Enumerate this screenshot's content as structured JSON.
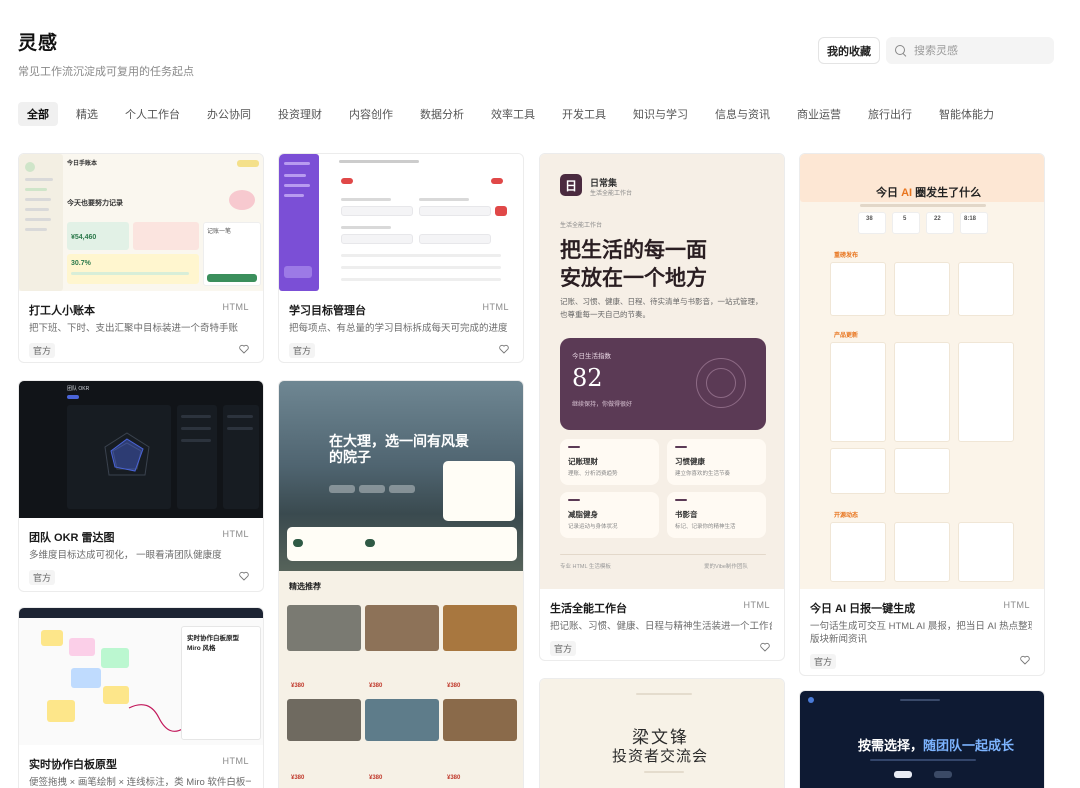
{
  "header": {
    "title": "灵感",
    "subtitle": "常见工作流沉淀成可复用的任务起点"
  },
  "actions": {
    "favorites_label": "我的收藏",
    "search_placeholder": "搜索灵感"
  },
  "tabs": [
    "全部",
    "精选",
    "个人工作台",
    "办公协同",
    "投资理财",
    "内容创作",
    "数据分析",
    "效率工具",
    "开发工具",
    "知识与学习",
    "信息与资讯",
    "商业运营",
    "旅行出行",
    "智能体能力"
  ],
  "cards": [
    {
      "title": "打工人小账本",
      "type": "HTML",
      "desc": "把下班、下时、支出汇聚中目标装进一个奇特手账",
      "tag": "官方"
    },
    {
      "title": "学习目标管理台",
      "type": "HTML",
      "desc": "把每项点、有总量的学习目标拆成每天可完成的进度",
      "tag": "官方"
    },
    {
      "title": "生活全能工作台",
      "type": "HTML",
      "desc": "把记账、习惯、健康、日程与精神生活装进一个工作台",
      "tag": "官方"
    },
    {
      "title": "今日 AI 日报一键生成",
      "type": "HTML",
      "desc": "一句话生成可交互 HTML AI 晨报，把当日 AI 热点整理成五",
      "desc2": "版块新闻资讯",
      "tag": "官方"
    },
    {
      "title": "团队 OKR 雷达图",
      "type": "HTML",
      "desc": "多维度目标达成可视化， 一眼看清团队健康度",
      "tag": "官方"
    },
    {
      "title": "实时协作白板原型",
      "type": "HTML",
      "desc": "便签拖拽 × 画笔绘制 × 连线标注，类 Miro 软件白板一键生"
    }
  ],
  "thumbs": {
    "ledger": {
      "heading": "今日手账本",
      "sub": "今天也要努力记录",
      "amount": "¥54,460",
      "percent": "30.7%",
      "note": "记账一笔"
    },
    "study": {
      "heading": "学习目标管理台"
    },
    "life": {
      "app_name": "日常集",
      "app_sub": "生活全能工作台",
      "eyebrow": "生活全能工作台",
      "headline_1": "把生活的每一面",
      "headline_2": "安放在一个地方",
      "body_1": "记账、习惯、健康、日程、待实清单与书影音，一站式管理，",
      "body_2": "也尊重每一天自己的节奏。",
      "stat_label": "今日生活指数",
      "stat_value": "82",
      "stat_sub": "继续保持，你做得很好",
      "tiles": [
        {
          "name": "记账理财",
          "sub": "理账、分析消费趋势"
        },
        {
          "name": "习惯健康",
          "sub": "建立你喜欢的生活节奏"
        },
        {
          "name": "减脂健身",
          "sub": "记录运动与身体状况"
        },
        {
          "name": "书影音",
          "sub": "标记、记录你的精神生活"
        }
      ],
      "footer_left": "专业 HTML 生活模板",
      "footer_right": "爱的Vibe制作团队"
    },
    "ai_daily": {
      "headline_prefix": "今日 ",
      "headline_ai": "AI",
      "headline_suffix": " 圈发生了什么",
      "stats": [
        "38",
        "5",
        "22",
        "8:18"
      ],
      "sections": [
        "重磅发布",
        "产品更新",
        "开源动态"
      ]
    },
    "okr": {
      "title": "团队 OKR"
    },
    "travel": {
      "headline_1": "在大理，选一间有风景",
      "headline_2": "的院子",
      "section": "精选推荐",
      "prices": [
        "¥380",
        "¥380",
        "¥380",
        "¥380",
        "¥380",
        "¥380"
      ]
    },
    "whiteboard": {
      "panel_title_1": "实时协作白板原型",
      "panel_title_2": "Miro 风格"
    },
    "investor": {
      "name": "梁文锋",
      "event": "投资者交流会"
    },
    "team_join": {
      "headline_1": "按需选择，",
      "headline_2": "随团队一起成长"
    }
  },
  "colors": {
    "accent_purple": "#5b3a55",
    "ai_orange": "#e8751f",
    "navy": "#0e1a33"
  }
}
